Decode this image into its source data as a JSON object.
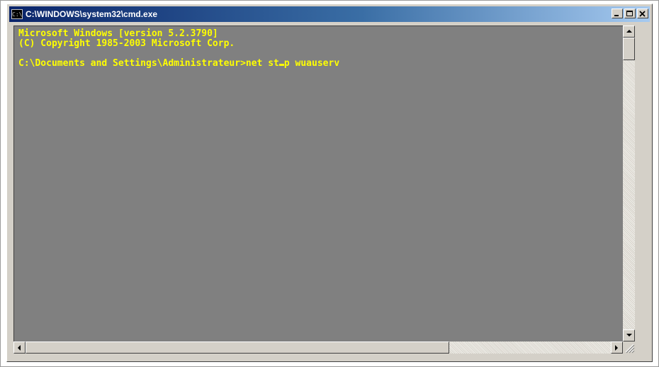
{
  "window": {
    "title": "C:\\WINDOWS\\system32\\cmd.exe",
    "app_icon_text": "C:\\",
    "icon": "cmd-icon"
  },
  "console": {
    "lines": [
      "Microsoft Windows [version 5.2.3790]",
      "(C) Copyright 1985-2003 Microsoft Corp.",
      "",
      "C:\\Documents and Settings\\Administrateur>net stop wuauserv"
    ],
    "prompt": "C:\\Documents and Settings\\Administrateur>",
    "command_before_cursor": "net st",
    "command_after_cursor": "p wuauserv",
    "text_color": "#ffff00",
    "background_color": "#808080"
  },
  "caption_buttons": [
    "minimize-icon",
    "maximize-icon",
    "close-icon"
  ]
}
